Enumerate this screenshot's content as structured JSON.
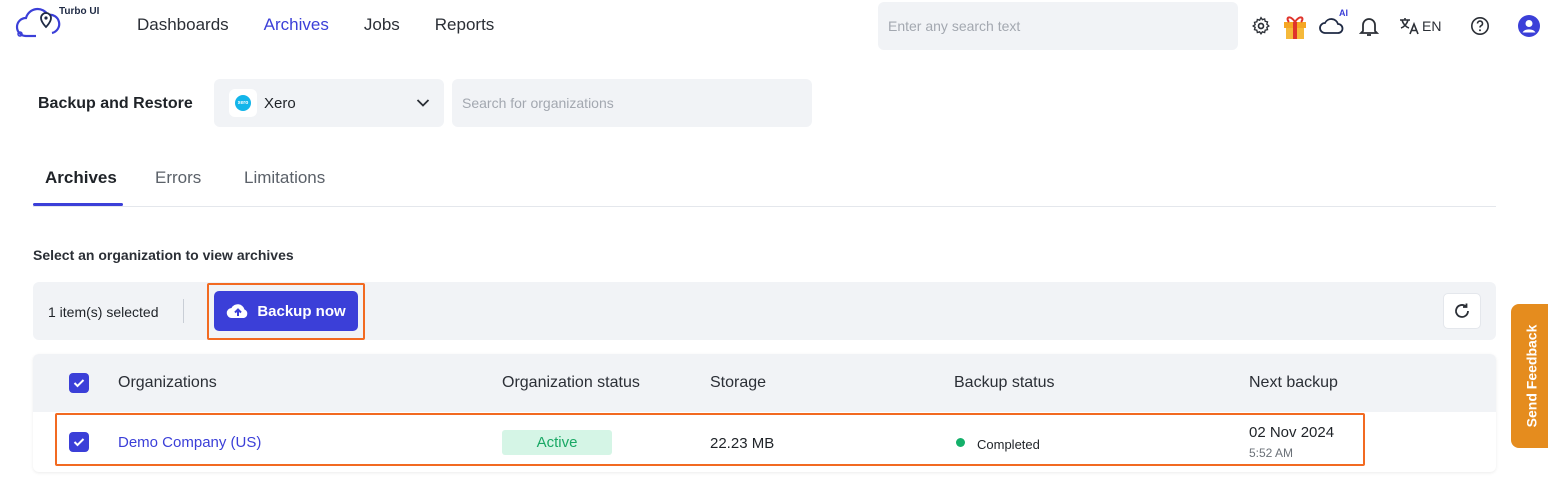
{
  "app": {
    "logo_text": "Turbo UI"
  },
  "nav": {
    "items": [
      "Dashboards",
      "Archives",
      "Jobs",
      "Reports"
    ],
    "active": "Archives"
  },
  "top_search": {
    "placeholder": "Enter any search text"
  },
  "top_icons": {
    "settings": "gear-icon",
    "gift": "gift-icon",
    "ai_cloud": "cloud-ai-icon",
    "ai_badge": "AI",
    "notifications": "bell-icon",
    "translate": "translate-icon",
    "language": "EN",
    "help": "help-icon",
    "profile": "user-avatar-icon"
  },
  "page": {
    "title": "Backup and Restore"
  },
  "app_select": {
    "value": "Xero",
    "logo_text": "xero"
  },
  "org_search": {
    "placeholder": "Search for organizations"
  },
  "tabs": {
    "items": [
      "Archives",
      "Errors",
      "Limitations"
    ],
    "active": "Archives"
  },
  "instruction": "Select an organization to view archives",
  "action_bar": {
    "selected_count": "1 item(s) selected",
    "backup_label": "Backup now"
  },
  "table": {
    "headers": [
      "Organizations",
      "Organization status",
      "Storage",
      "Backup status",
      "Next backup"
    ],
    "rows": [
      {
        "organization": "Demo Company (US)",
        "status": "Active",
        "storage": "22.23 MB",
        "backup_status": "Completed",
        "next_backup_date": "02 Nov 2024",
        "next_backup_time": "5:52 AM",
        "selected": true
      }
    ]
  },
  "feedback": {
    "label": "Send Feedback"
  },
  "colors": {
    "accent": "#3b3fd8",
    "highlight": "#f26a21",
    "feedback": "#e58c1e",
    "active_badge_bg": "#d5f5e6",
    "active_badge_text": "#1aa865"
  }
}
